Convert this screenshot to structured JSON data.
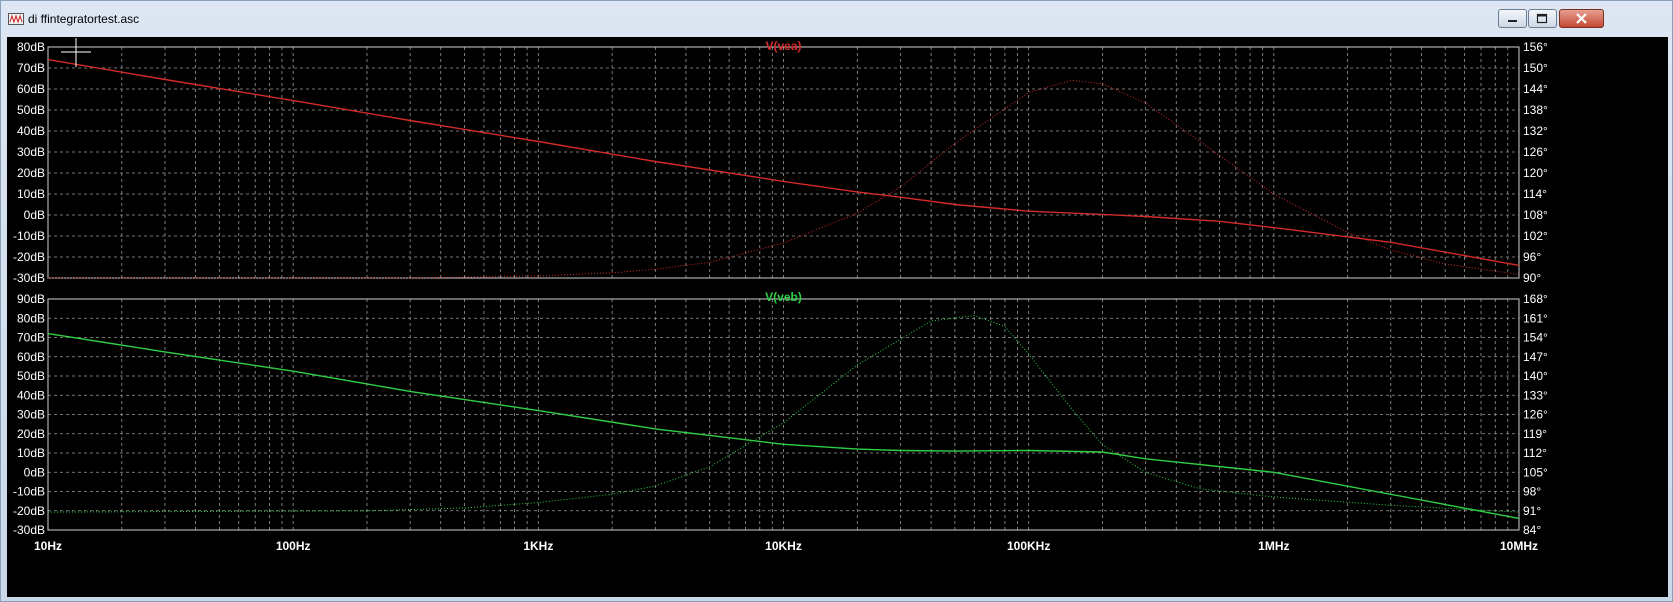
{
  "window": {
    "title": "di ffintegratortest.asc",
    "icon": "schematic-icon",
    "buttons": [
      "minimize",
      "maximize",
      "close"
    ]
  },
  "colors": {
    "background": "#000000",
    "grid": "#9a9a9a",
    "axis_text": "#ffffff",
    "vea": "#d42a2a",
    "veb": "#2fcf45"
  },
  "chart_data": [
    {
      "type": "line",
      "title": "V(vea)",
      "xscale": "log",
      "xlim": [
        10,
        10000000
      ],
      "x_ticks": [
        "10Hz",
        "100Hz",
        "1KHz",
        "10KHz",
        "100KHz",
        "1MHz",
        "10MHz"
      ],
      "ylim": [
        -30,
        80
      ],
      "y_ticks": [
        "80dB",
        "70dB",
        "60dB",
        "50dB",
        "40dB",
        "30dB",
        "20dB",
        "10dB",
        "0dB",
        "-10dB",
        "-20dB",
        "-30dB"
      ],
      "y2lim": [
        90,
        156
      ],
      "y2_ticks": [
        "156°",
        "150°",
        "144°",
        "138°",
        "132°",
        "126°",
        "120°",
        "114°",
        "108°",
        "102°",
        "96°",
        "90°"
      ],
      "grid": true,
      "series": [
        {
          "name": "V(vea)",
          "quantity": "magnitude",
          "style": "solid",
          "x": [
            10,
            30,
            100,
            300,
            1000,
            3000,
            10000,
            20000,
            30000,
            50000,
            100000,
            200000,
            300000,
            600000,
            1000000,
            3000000,
            10000000
          ],
          "y": [
            74,
            64.5,
            54.5,
            45,
            35,
            25.5,
            16,
            11,
            8.5,
            5,
            1.8,
            0.3,
            -0.7,
            -3,
            -6,
            -13,
            -24
          ]
        },
        {
          "name": "V(vea)",
          "quantity": "phase",
          "style": "dotted",
          "x": [
            10,
            300,
            1000,
            2000,
            3000,
            5000,
            10000,
            20000,
            30000,
            50000,
            100000,
            150000,
            200000,
            300000,
            500000,
            1000000,
            2000000,
            3000000,
            5000000,
            10000000
          ],
          "y": [
            90,
            90,
            90.6,
            91.5,
            92.5,
            94.5,
            100,
            108.5,
            116,
            128.5,
            143,
            146.5,
            145.5,
            140,
            129,
            114,
            103,
            98,
            94,
            91
          ]
        }
      ]
    },
    {
      "type": "line",
      "title": "V(veb)",
      "xscale": "log",
      "xlim": [
        10,
        10000000
      ],
      "x_ticks": [
        "10Hz",
        "100Hz",
        "1KHz",
        "10KHz",
        "100KHz",
        "1MHz",
        "10MHz"
      ],
      "ylim": [
        -30,
        90
      ],
      "y_ticks": [
        "90dB",
        "80dB",
        "70dB",
        "60dB",
        "50dB",
        "40dB",
        "30dB",
        "20dB",
        "10dB",
        "0dB",
        "-10dB",
        "-20dB",
        "-30dB"
      ],
      "y2lim": [
        84,
        168
      ],
      "y2_ticks": [
        "168°",
        "161°",
        "154°",
        "147°",
        "140°",
        "133°",
        "126°",
        "119°",
        "112°",
        "105°",
        "98°",
        "91°",
        "84°"
      ],
      "grid": true,
      "series": [
        {
          "name": "V(veb)",
          "quantity": "magnitude",
          "style": "solid",
          "x": [
            10,
            30,
            100,
            300,
            1000,
            3000,
            10000,
            20000,
            30000,
            50000,
            100000,
            200000,
            300000,
            1000000,
            10000000
          ],
          "y": [
            72,
            62.5,
            52.5,
            42,
            32,
            22.5,
            14.5,
            12,
            11.3,
            11,
            11.3,
            10.5,
            7,
            0,
            -24
          ]
        },
        {
          "name": "V(veb)",
          "quantity": "phase",
          "style": "dotted",
          "x": [
            10,
            200,
            500,
            1000,
            2000,
            3000,
            5000,
            10000,
            20000,
            40000,
            60000,
            80000,
            100000,
            150000,
            200000,
            300000,
            500000,
            1000000,
            3000000,
            10000000
          ],
          "y": [
            90.5,
            91,
            92,
            94,
            97,
            100,
            107,
            123,
            144,
            160,
            162,
            158,
            148,
            128,
            115,
            105,
            99,
            96,
            93,
            90.5
          ]
        }
      ]
    }
  ]
}
